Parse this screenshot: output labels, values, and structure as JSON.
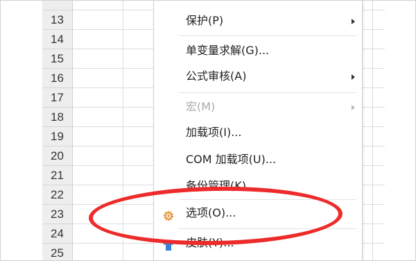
{
  "spreadsheet": {
    "rows": [
      "13",
      "14",
      "15",
      "16",
      "17",
      "18",
      "19",
      "20",
      "21",
      "22",
      "23",
      "24",
      "25"
    ]
  },
  "menu": {
    "items": [
      {
        "label": "保护(P)",
        "submenu": true,
        "enabled": true
      },
      {
        "label": "单变量求解(G)...",
        "submenu": false,
        "enabled": true
      },
      {
        "label": "公式审核(A)",
        "submenu": true,
        "enabled": true
      },
      {
        "label": "宏(M)",
        "submenu": true,
        "enabled": false
      },
      {
        "label": "加载项(I)...",
        "submenu": false,
        "enabled": true
      },
      {
        "label": "COM 加载项(U)...",
        "submenu": false,
        "enabled": true
      },
      {
        "label": "备份管理(K)",
        "submenu": false,
        "enabled": true
      },
      {
        "label": "选项(O)...",
        "submenu": false,
        "enabled": true,
        "icon": "gear-icon"
      },
      {
        "label": "皮肤(Y)...",
        "submenu": false,
        "enabled": true,
        "icon": "shirt-icon"
      }
    ]
  },
  "colors": {
    "highlight": "#ee2b2b",
    "gear": "#e08a2a",
    "shirt": "#3b7fd6"
  }
}
